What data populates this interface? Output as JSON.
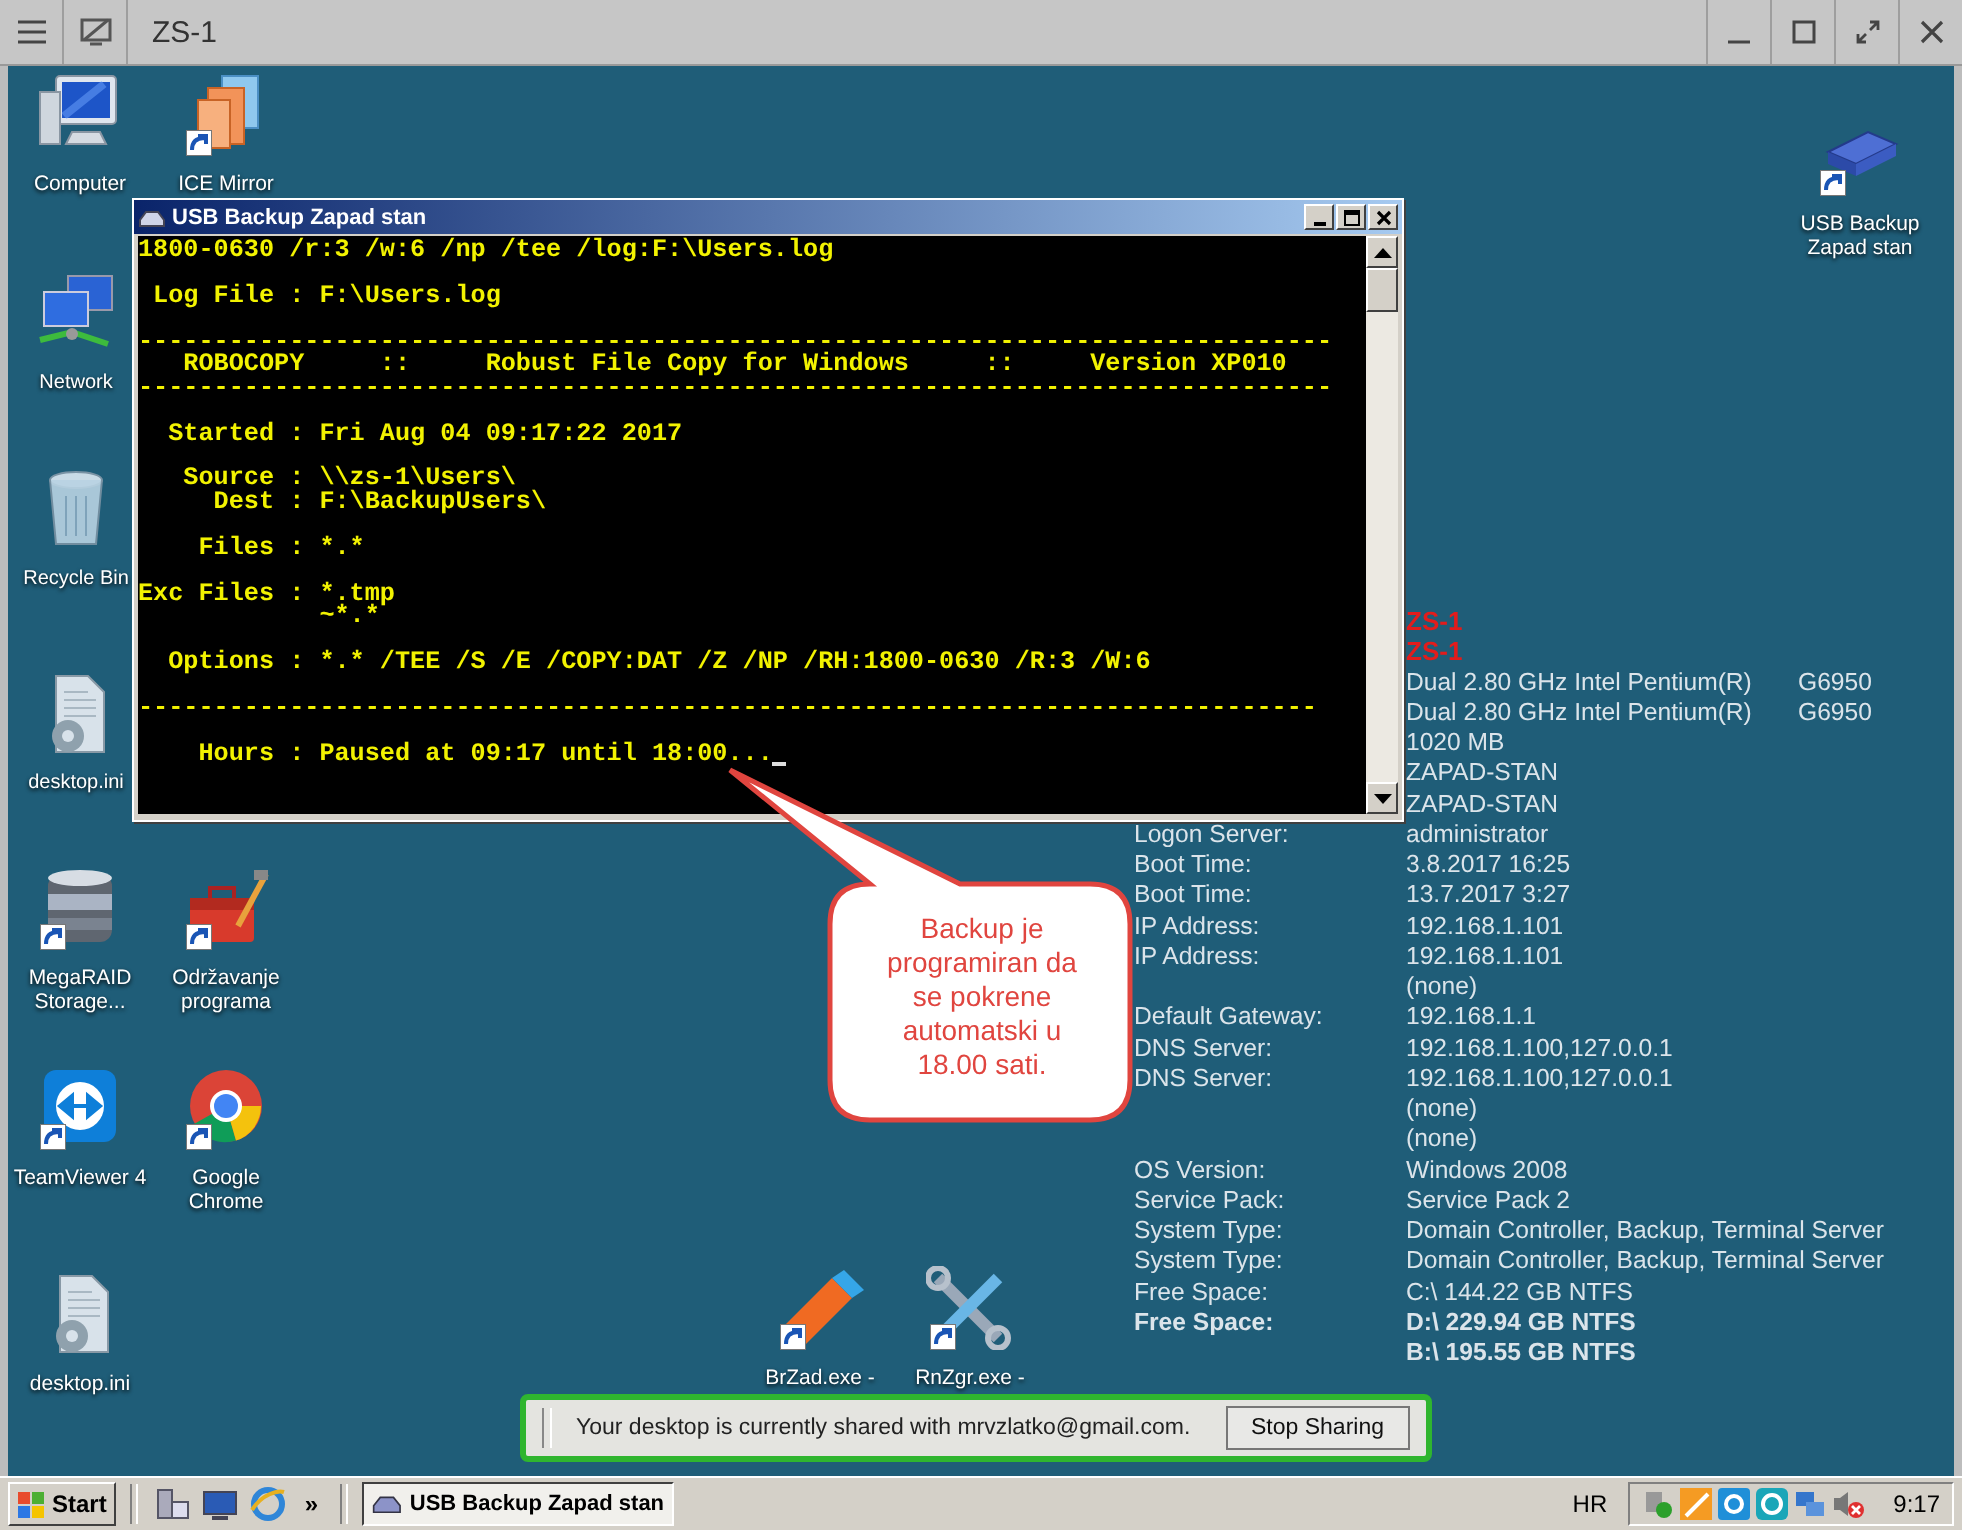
{
  "viewer": {
    "title": "ZS-1"
  },
  "desktop_icons": [
    {
      "label": "Computer",
      "kind": "computer",
      "shortcut": false
    },
    {
      "label": "ICE Mirror",
      "kind": "documents",
      "shortcut": true
    },
    {
      "label": "Network",
      "kind": "network",
      "shortcut": false
    },
    {
      "label": "Recycle Bin",
      "kind": "recycle-bin",
      "shortcut": false
    },
    {
      "label": "desktop.ini",
      "kind": "settings-file",
      "shortcut": false
    },
    {
      "label": "MegaRAID Storage...",
      "kind": "database",
      "shortcut": true
    },
    {
      "label": "Održavanje programa",
      "kind": "toolbox",
      "shortcut": true
    },
    {
      "label": "TeamViewer 4",
      "kind": "remote",
      "shortcut": true
    },
    {
      "label": "Google Chrome",
      "kind": "browser",
      "shortcut": true
    },
    {
      "label": "desktop.ini",
      "kind": "settings-file",
      "shortcut": false
    },
    {
      "label": "BrZad.exe -",
      "kind": "eraser",
      "shortcut": true
    },
    {
      "label": "RnZgr.exe -",
      "kind": "tools",
      "shortcut": true
    },
    {
      "label": "USB Backup Zapad stan",
      "kind": "usb-drive",
      "shortcut": true
    }
  ],
  "info_panel": [
    {
      "kind": "host",
      "value": "ZS-1"
    },
    {
      "kind": "host",
      "value": "ZS-1"
    },
    {
      "kind": "plain",
      "value": "Dual 2.80 GHz Intel Pentium(R)",
      "extra": "G6950"
    },
    {
      "kind": "plain",
      "value": "Dual 2.80 GHz Intel Pentium(R)",
      "extra": "G6950"
    },
    {
      "kind": "plain",
      "value": "1020 MB"
    },
    {
      "kind": "plain",
      "value": "ZAPAD-STAN"
    },
    {
      "kind": "plain",
      "value": "ZAPAD-STAN"
    },
    {
      "kind": "plain",
      "label": "Logon Server:",
      "value": "administrator"
    },
    {
      "kind": "plain",
      "label": "Boot Time:",
      "value": "3.8.2017 16:25"
    },
    {
      "kind": "plain",
      "label": "Boot Time:",
      "value": "13.7.2017 3:27"
    },
    {
      "kind": "plain",
      "label": "IP Address:",
      "value": "192.168.1.101"
    },
    {
      "kind": "plain",
      "label": "IP Address:",
      "value": "192.168.1.101"
    },
    {
      "kind": "plain",
      "value": "(none)"
    },
    {
      "kind": "plain",
      "label": "Default Gateway:",
      "value": "192.168.1.1"
    },
    {
      "kind": "plain",
      "label": "DNS Server:",
      "value": "192.168.1.100,127.0.0.1"
    },
    {
      "kind": "plain",
      "label": "DNS Server:",
      "value": "192.168.1.100,127.0.0.1"
    },
    {
      "kind": "plain",
      "value": "(none)"
    },
    {
      "kind": "plain",
      "value": "(none)"
    },
    {
      "kind": "plain",
      "label": "OS Version:",
      "value": "Windows 2008"
    },
    {
      "kind": "plain",
      "label": "Service Pack:",
      "value": "Service Pack 2"
    },
    {
      "kind": "plain",
      "label": "System Type:",
      "value": "Domain Controller, Backup, Terminal Server"
    },
    {
      "kind": "plain",
      "label": "System Type:",
      "value": "Domain Controller, Backup, Terminal Server"
    },
    {
      "kind": "plain",
      "label": "Free Space:",
      "value": "C:\\ 144.22 GB NTFS"
    },
    {
      "kind": "bold",
      "label": "Free Space:",
      "value": "D:\\ 229.94 GB NTFS"
    },
    {
      "kind": "bold",
      "value": "B:\\ 195.55 GB NTFS"
    }
  ],
  "console_window": {
    "title": "USB Backup Zapad stan",
    "lines": [
      {
        "text": "1800-0630 /r:3 /w:6 /np /tee /log:F:\\Users.log",
        "blank_before": false
      },
      {
        "text": " Log File : F:\\Users.log",
        "blank_before": true
      },
      {
        "text": "-------------------------------------------------------------------------------",
        "blank_before": true
      },
      {
        "text": "   ROBOCOPY     ::     Robust File Copy for Windows     ::     Version XP010",
        "blank_before": false
      },
      {
        "text": "-------------------------------------------------------------------------------",
        "blank_before": false
      },
      {
        "text": "  Started : Fri Aug 04 09:17:22 2017",
        "blank_before": true
      },
      {
        "text": "   Source : \\\\zs-1\\Users\\",
        "blank_before": true
      },
      {
        "text": "     Dest : F:\\BackupUsers\\",
        "blank_before": false
      },
      {
        "text": "    Files : *.*",
        "blank_before": true
      },
      {
        "text": "Exc Files : *.tmp",
        "blank_before": true
      },
      {
        "text": "            ~*.*",
        "blank_before": false
      },
      {
        "text": "  Options : *.* /TEE /S /E /COPY:DAT /Z /NP /RH:1800-0630 /R:3 /W:6",
        "blank_before": true
      },
      {
        "text": "------------------------------------------------------------------------------",
        "blank_before": true
      },
      {
        "text": "    Hours : Paused at 09:17 until 18:00...",
        "blank_before": true
      }
    ]
  },
  "callout": {
    "text": "Backup je programiran da se pokrene automatski u 18.00 sati."
  },
  "share_bar": {
    "message": "Your desktop is currently shared with mrvzlatko@gmail.com.",
    "button": "Stop Sharing"
  },
  "taskbar": {
    "start": "Start",
    "more": "»",
    "tasks": [
      {
        "label": "USB Backup Zapad stan",
        "active": true
      }
    ],
    "language": "HR",
    "clock": "9:17"
  }
}
